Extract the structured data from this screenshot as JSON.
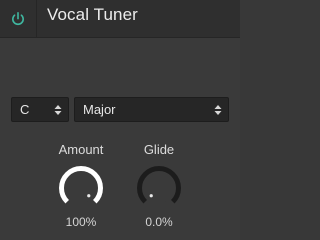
{
  "header": {
    "title": "Vocal Tuner",
    "power_on": true,
    "power_color": "#3fb7a0"
  },
  "key_select": {
    "value": "C"
  },
  "scale_select": {
    "value": "Major"
  },
  "knobs": [
    {
      "label": "Amount",
      "value_text": "100%",
      "level": 1.0,
      "color": "#ffffff"
    },
    {
      "label": "Glide",
      "value_text": "0.0%",
      "level": 0.0,
      "color": "#ffffff"
    }
  ]
}
